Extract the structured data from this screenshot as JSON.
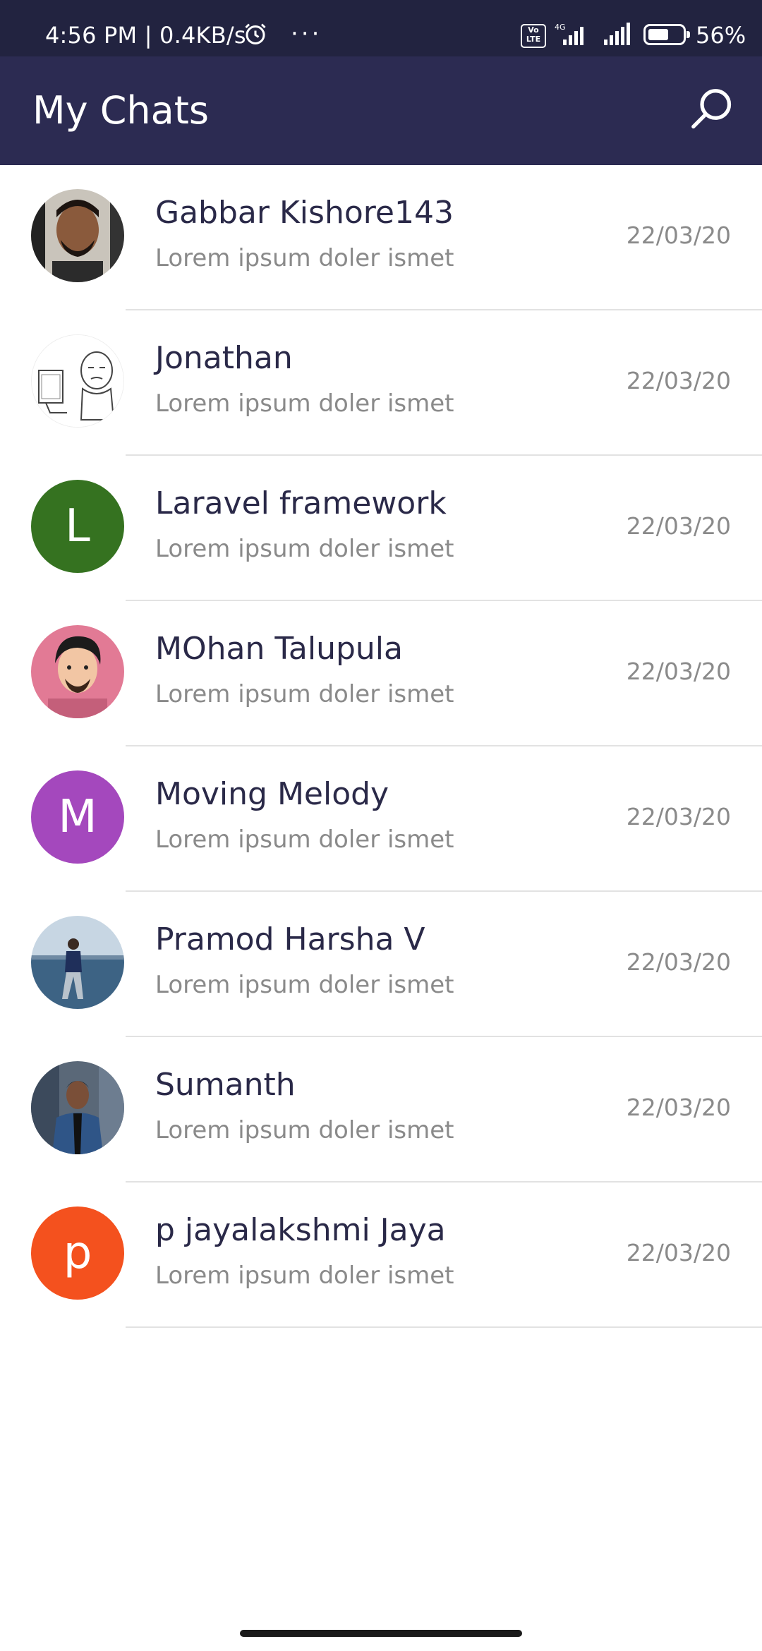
{
  "status_bar": {
    "time": "4:56 PM | 0.4KB/s",
    "more": "···",
    "volte": "Vo LTE",
    "network": "4G",
    "battery": "56%"
  },
  "app_bar": {
    "title": "My Chats",
    "search_icon": "search-icon"
  },
  "chats": [
    {
      "name": "Gabbar Kishore143",
      "message": "Lorem ipsum doler ismet",
      "date": "22/03/20",
      "avatar": "photo-man-beard",
      "color": "#3b3b3b",
      "initial": ""
    },
    {
      "name": "Jonathan",
      "message": "Lorem ipsum doler ismet",
      "date": "22/03/20",
      "avatar": "sketch-computer-guy",
      "color": "#ffffff",
      "initial": ""
    },
    {
      "name": "Laravel framework",
      "message": "Lorem ipsum doler ismet",
      "date": "22/03/20",
      "avatar": "letter",
      "color": "#357220",
      "initial": "L"
    },
    {
      "name": "MOhan Talupula",
      "message": "Lorem ipsum doler ismet",
      "date": "22/03/20",
      "avatar": "cartoon-man-pink",
      "color": "#e27a95",
      "initial": ""
    },
    {
      "name": "Moving Melody",
      "message": "Lorem ipsum doler ismet",
      "date": "22/03/20",
      "avatar": "letter",
      "color": "#a448bd",
      "initial": "M"
    },
    {
      "name": "Pramod Harsha V",
      "message": "Lorem ipsum doler ismet",
      "date": "22/03/20",
      "avatar": "photo-man-sea",
      "color": "#4a6f93",
      "initial": ""
    },
    {
      "name": "Sumanth",
      "message": "Lorem ipsum doler ismet",
      "date": "22/03/20",
      "avatar": "photo-man-denim",
      "color": "#2f4f7a",
      "initial": ""
    },
    {
      "name": "p jayalakshmi Jaya",
      "message": "Lorem ipsum doler ismet",
      "date": "22/03/20",
      "avatar": "letter",
      "color": "#f4511e",
      "initial": "p"
    }
  ]
}
